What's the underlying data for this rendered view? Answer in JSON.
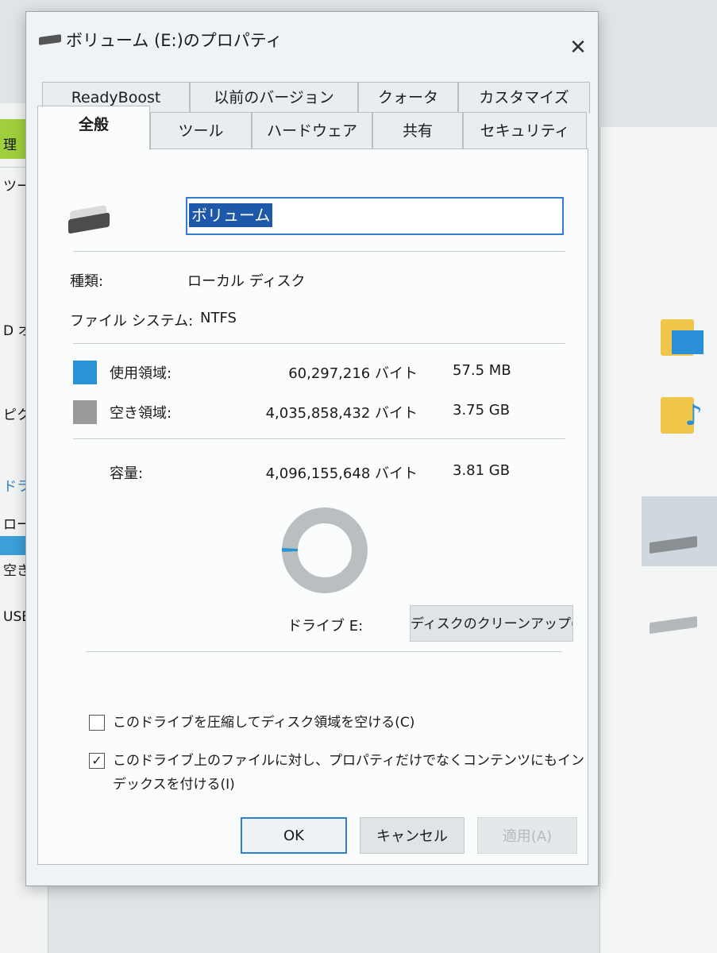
{
  "dialog": {
    "title": "ボリューム (E:)のプロパティ",
    "close_glyph": "✕"
  },
  "tabs": {
    "back": [
      "ReadyBoost",
      "以前のバージョン",
      "クォータ",
      "カスタマイズ"
    ],
    "front": [
      "全般",
      "ツール",
      "ハードウェア",
      "共有",
      "セキュリティ"
    ],
    "active": "全般"
  },
  "general": {
    "volume_name": "ボリューム",
    "type_label": "種類:",
    "type_value": "ローカル ディスク",
    "fs_label": "ファイル システム:",
    "fs_value": "NTFS",
    "used": {
      "label": "使用領域:",
      "bytes": "60,297,216 バイト",
      "size": "57.5 MB",
      "color": "#2a93d5"
    },
    "free": {
      "label": "空き領域:",
      "bytes": "4,035,858,432 バイト",
      "size": "3.75 GB",
      "color": "#9a9a9a"
    },
    "capacity": {
      "label": "容量:",
      "bytes": "4,096,155,648 バイト",
      "size": "3.81 GB"
    },
    "used_fraction": 0.0147,
    "drive_label": "ドライブ E:",
    "cleanup_button": "ディスクのクリーンアップ(D)",
    "compress_checkbox": {
      "label": "このドライブを圧縮してディスク領域を空ける(C)",
      "checked": false
    },
    "index_checkbox": {
      "label_line1": "このドライブ上のファイルに対し、プロパティだけでなくコンテンツにもイン",
      "label_line2": "デックスを付ける(I)",
      "checked": true
    }
  },
  "buttons": {
    "ok": "OK",
    "cancel": "キャンセル",
    "apply": "適用(A)"
  },
  "background": {
    "left_items": [
      "理",
      "ツー",
      "D オ",
      "ピクチャ",
      "ドライブ",
      "ローカル",
      "空き領",
      "USB ド"
    ]
  }
}
